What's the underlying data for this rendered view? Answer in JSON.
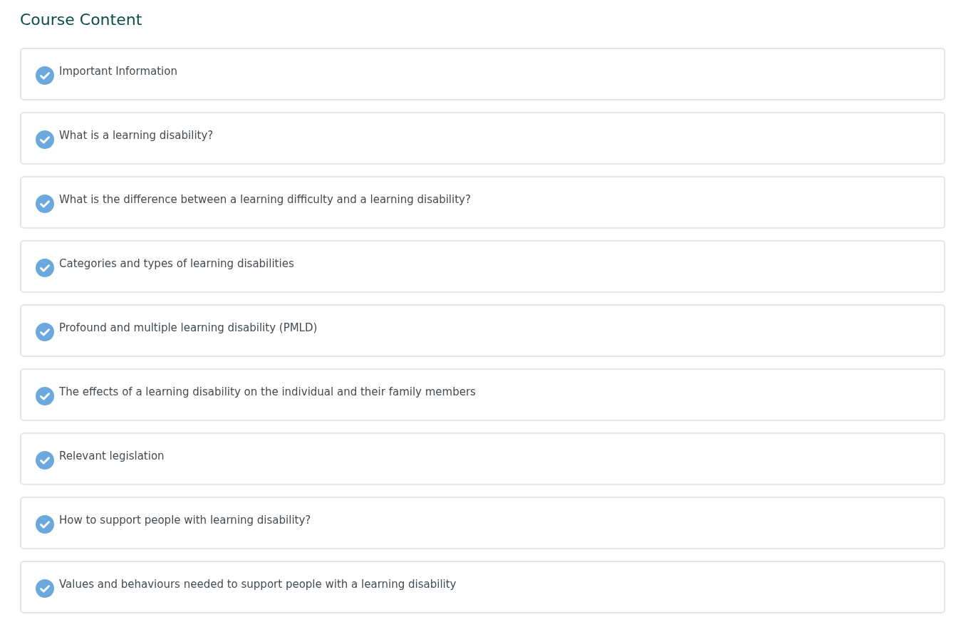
{
  "heading": "Course Content",
  "lessons": [
    {
      "title": "Important Information",
      "completed": true
    },
    {
      "title": "What is a learning disability?",
      "completed": true
    },
    {
      "title": "What is the difference between a learning difficulty and a learning disability?",
      "completed": true
    },
    {
      "title": "Categories and types of learning disabilities",
      "completed": true
    },
    {
      "title": "Profound and multiple learning disability (PMLD)",
      "completed": true
    },
    {
      "title": "The effects of a learning disability on the individual and their family members",
      "completed": true
    },
    {
      "title": "Relevant legislation",
      "completed": true
    },
    {
      "title": "How to support people with learning disability?",
      "completed": true
    },
    {
      "title": "Values and behaviours needed to support people with a learning disability",
      "completed": true
    }
  ]
}
